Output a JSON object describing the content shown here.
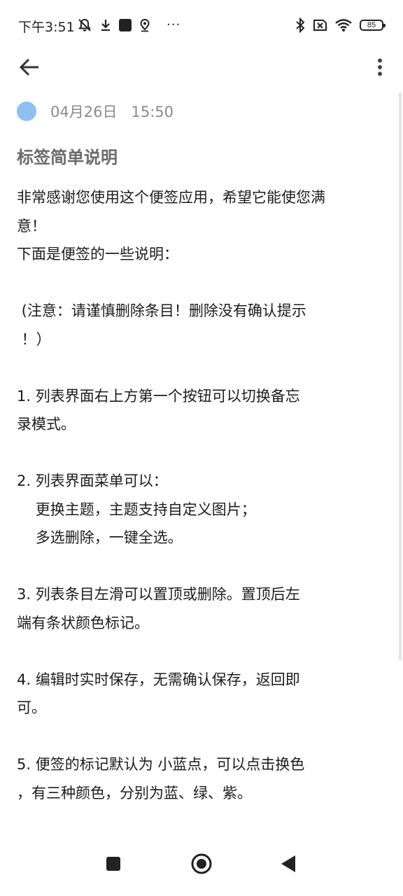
{
  "status_bar": {
    "time": "下午3:51",
    "left_icons": [
      "muted-bell-icon",
      "download-icon",
      "app-square-icon",
      "location-icon"
    ],
    "more": "···",
    "right_icons": [
      "bluetooth-icon",
      "sim-disabled-icon",
      "wifi-icon"
    ],
    "battery_level": "85"
  },
  "app_bar": {
    "back_icon": "arrow-left-icon",
    "overflow_icon": "more-vert-icon"
  },
  "note": {
    "color_dot": "#90bff2",
    "date": "04月26日",
    "time": "15:50",
    "title": "标签简单说明",
    "lines": [
      "非常感谢您使用这个便签应用，希望它能使您满",
      "意！",
      "下面是便签的一些说明：",
      "",
      " (注意：请谨慎删除条目！删除没有确认提示",
      " ！）",
      "",
      "1. 列表界面右上方第一个按钮可以切换备忘",
      "录模式。",
      "",
      "2. 列表界面菜单可以：",
      "    更换主题，主题支持自定义图片；",
      "    多选删除，一键全选。",
      "",
      "3. 列表条目左滑可以置顶或删除。置顶后左",
      "端有条状颜色标记。",
      "",
      "4. 编辑时实时保存，无需确认保存，返回即",
      "可。",
      "",
      "5. 便签的标记默认为 小蓝点，可以点击换色",
      "，有三种颜色，分别为蓝、绿、紫。"
    ]
  },
  "nav_bar": {
    "recent_icon": "recents-square-icon",
    "home_icon": "home-circle-icon",
    "back_icon": "back-triangle-icon"
  }
}
